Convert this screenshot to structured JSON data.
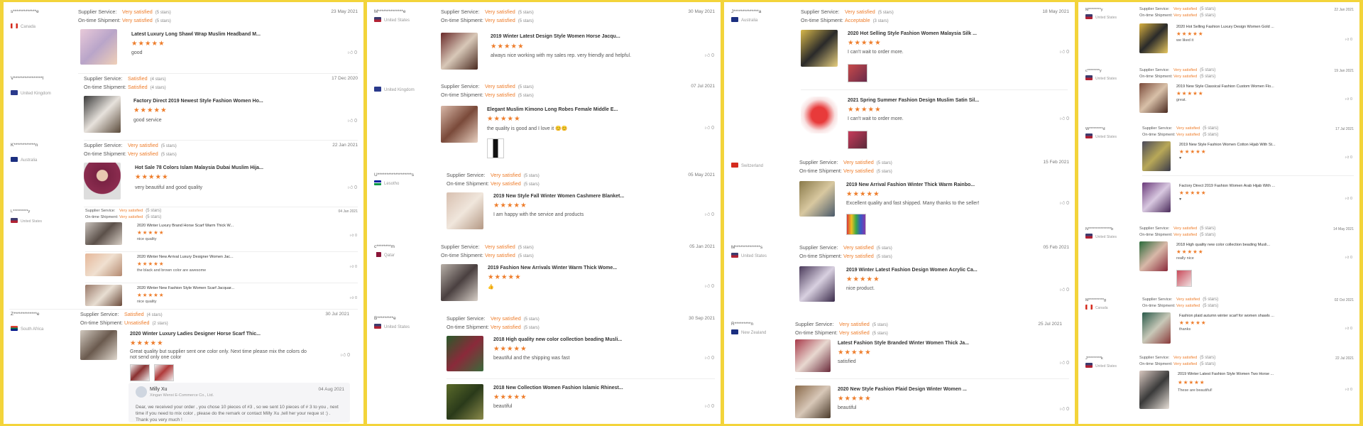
{
  "labels": {
    "supplier": "Supplier Service:",
    "shipment": "On-time Shipment:"
  },
  "colors": {
    "accent": "#ee7d2b",
    "frame": "#f3d43a"
  },
  "col1": [
    {
      "user": "s*************e",
      "country": "Canada",
      "flag": "ca",
      "svc": "Very satisfied",
      "svcStars": "(5 stars)",
      "ship": "Very satisfied",
      "shipStars": "(5 stars)",
      "date": "23 May 2021",
      "items": [
        {
          "title": "Latest Luxury Long Shawl Wrap Muslim Headband M...",
          "stars": "★★★★★",
          "comment": "good",
          "likes": "0"
        }
      ]
    },
    {
      "user": "V****************l",
      "country": "United Kingdom",
      "flag": "gb",
      "svc": "Satisfied",
      "svcStars": "(4 stars)",
      "ship": "Satisfied",
      "shipStars": "(4 stars)",
      "date": "17 Dec 2020",
      "items": [
        {
          "title": "Factory Direct 2019 Newest Style Fashion Women Ho...",
          "stars": "★★★★★",
          "comment": "good service",
          "likes": "0"
        }
      ]
    },
    {
      "user": "K************n",
      "country": "Australia",
      "flag": "au",
      "svc": "Very satisfied",
      "svcStars": "(5 stars)",
      "ship": "Very satisfied",
      "shipStars": "(5 stars)",
      "date": "22 Jan 2021",
      "items": [
        {
          "title": "Hot Sale 78 Colors Islam Malaysia Dubai Muslim Hija...",
          "stars": "★★★★★",
          "comment": "very beautiful and good quality",
          "likes": "0"
        }
      ]
    },
    {
      "user": "L**********y",
      "country": "United States",
      "flag": "us",
      "svc": "Very satisfied",
      "svcStars": "(5 stars)",
      "ship": "Very satisfied",
      "shipStars": "(5 stars)",
      "date": "04 Jan 2021",
      "items": [
        {
          "title": "2020 Winter Luxury Brand Horse Scarf Warm Thick W...",
          "stars": "★★★★★",
          "comment": "nice quality",
          "likes": "0"
        },
        {
          "title": "2020 Winter New Arrival Luxury Designer Women Jac...",
          "stars": "★★★★★",
          "comment": "the black and brown color are awesome",
          "likes": "0"
        },
        {
          "title": "2020 Winter New Fashion Style Women Scarf Jacquar...",
          "stars": "★★★★★",
          "comment": "nice quality",
          "likes": "0"
        }
      ]
    },
    {
      "user": "Z*************e",
      "country": "South Africa",
      "flag": "za",
      "svc": "Satisfied",
      "svcStars": "(4 stars)",
      "ship": "Unsatisfied",
      "shipStars": "(2 stars)",
      "date": "30 Jul 2021",
      "items": [
        {
          "title": "2020 Winter Luxury Ladies Designer Horse Scarf Thic...",
          "stars": "★★★★★",
          "comment": "Great quality but supplier sent one color only. Next time please mix the colors do",
          "comment2": "not send only one color",
          "likes": "0"
        }
      ],
      "reply": {
        "name": "Milly Xu",
        "company": "Xingan Wenxi E-Commerce Co., Ltd.",
        "date": "04 Aug 2021",
        "text": "Dear, we received your order , you chose 10 pieces of #3 , so we sent 10 pieces of # 3 to you , next time if you need to mix color , please do the remark or contact Milly Xu ,tell her your reque st :) . Thank you very much !"
      }
    }
  ],
  "col2": [
    {
      "user": "M**************e",
      "country": "United States",
      "flag": "us",
      "svc": "Very satisfied",
      "svcStars": "(5 stars)",
      "ship": "Very satisfied",
      "shipStars": "(5 stars)",
      "date": "30 May 2021",
      "items": [
        {
          "title": "2019 Winter Latest Design Style Women Horse Jacqu...",
          "stars": "★★★★★",
          "comment": "always nice working with my sales rep. very friendly and helpful.",
          "likes": "0"
        }
      ]
    },
    {
      "user": "",
      "country": "United Kingdom",
      "flag": "gb",
      "svc": "Very satisfied",
      "svcStars": "(5 stars)",
      "ship": "Very satisfied",
      "shipStars": "(5 stars)",
      "date": "07 Jul 2021",
      "items": [
        {
          "title": "Elegant Muslim Kimono Long Robes Female Middle E...",
          "stars": "★★★★★",
          "comment": "the quality is good and I love it 😊😊",
          "likes": "0"
        }
      ]
    },
    {
      "user": "U*******************s",
      "country": "Lesotho",
      "flag": "ls",
      "svc": "Very satisfied",
      "svcStars": "(5 stars)",
      "ship": "Very satisfied",
      "shipStars": "(5 stars)",
      "date": "05 May 2021",
      "items": [
        {
          "title": "2019 New Style Fall Winter Women Cashmere Blanket...",
          "stars": "★★★★★",
          "comment": "I am happy with the service and products",
          "likes": "0"
        }
      ]
    },
    {
      "user": "c********m",
      "country": "Qatar",
      "flag": "qa",
      "svc": "Very satisfied",
      "svcStars": "(5 stars)",
      "ship": "Very satisfied",
      "shipStars": "(5 stars)",
      "date": "05 Jan 2021",
      "items": [
        {
          "title": "2019 Fashion New Arrivals Winter Warm Thick Wome...",
          "stars": "★★★★★",
          "comment": "👍",
          "likes": "0"
        }
      ]
    },
    {
      "user": "B*********e",
      "country": "United States",
      "flag": "us",
      "svc": "Very satisfied",
      "svcStars": "(5 stars)",
      "ship": "Very satisfied",
      "shipStars": "(5 stars)",
      "date": "30 Sep 2021",
      "items": [
        {
          "title": "2018 High quality new color collection beading Musli...",
          "stars": "★★★★★",
          "comment": "beautiful and the shipping was fast",
          "likes": "0"
        },
        {
          "title": "2018 New Collection Women Fashion Islamic Rhinest...",
          "stars": "★★★★★",
          "comment": "beautiful",
          "likes": "0"
        }
      ]
    }
  ],
  "col3": [
    {
      "user": "J**************a",
      "country": "Australia",
      "flag": "au",
      "svc": "Very satisfied",
      "svcStars": "(5 stars)",
      "ship": "Acceptable",
      "shipStars": "(3 stars)",
      "date": "18 May 2021",
      "items": [
        {
          "title": "2020 Hot Selling Style Fashion Women Malaysia Silk ...",
          "stars": "★★★★★",
          "comment": "I can't wait to order more.",
          "likes": "0"
        },
        {
          "title": "2021 Spring Summer Fashion Design Muslim Satin Sil...",
          "stars": "★★★★★",
          "comment": "I can't wait to order more.",
          "likes": "0"
        }
      ]
    },
    {
      "user": "",
      "country": "Switzerland",
      "flag": "ch",
      "svc": "Very satisfied",
      "svcStars": "(5 stars)",
      "ship": "Very satisfied",
      "shipStars": "(5 stars)",
      "date": "15 Feb 2021",
      "items": [
        {
          "title": "2019 New Arrival Fashion Winter Thick Warm Rainbo...",
          "stars": "★★★★★",
          "comment": "Excellent quality and fast shipped. Many thanks to the seller!",
          "likes": "0"
        }
      ]
    },
    {
      "user": "M**************s",
      "country": "United States",
      "flag": "us",
      "svc": "Very satisfied",
      "svcStars": "(5 stars)",
      "ship": "Very satisfied",
      "shipStars": "(5 stars)",
      "date": "05 Feb 2021",
      "items": [
        {
          "title": "2019 Winter Latest Fashion Design Women Acrylic Ca...",
          "stars": "★★★★★",
          "comment": "nice product.",
          "likes": "0"
        }
      ]
    },
    {
      "user": "R*********n",
      "country": "New Zealand",
      "flag": "nz",
      "svc": "Very satisfied",
      "svcStars": "(5 stars)",
      "ship": "Very satisfied",
      "shipStars": "(5 stars)",
      "date": "25 Jul 2021",
      "items": [
        {
          "title": "Latest Fashion Style Branded Winter Women Thick Ja...",
          "stars": "★★★★★",
          "comment": "satisfied",
          "likes": "0"
        },
        {
          "title": "2020 New Style Fashion Plaid Design Winter Women ...",
          "stars": "★★★★★",
          "comment": "beautiful",
          "likes": "0"
        }
      ]
    }
  ],
  "col4": [
    {
      "user": "M********y",
      "country": "United States",
      "flag": "us",
      "svc": "Very satisfied",
      "svcStars": "(5 stars)",
      "ship": "Very satisfied",
      "shipStars": "(5 stars)",
      "date": "22 Jan 2021",
      "items": [
        {
          "title": "2020 Hot Selling Fashion Luxury Design Women Gold ...",
          "stars": "★★★★★",
          "comment": "we liked it",
          "likes": "0"
        }
      ]
    },
    {
      "user": "c********y",
      "country": "United States",
      "flag": "us",
      "svc": "Very satisfied",
      "svcStars": "(5 stars)",
      "ship": "Very satisfied",
      "shipStars": "(5 stars)",
      "date": "19 Jan 2021",
      "items": [
        {
          "title": "2019 New Style Classical Fashion Custom Women Flo...",
          "stars": "★★★★★",
          "comment": "great.",
          "likes": "0"
        }
      ]
    },
    {
      "user": "W*********d",
      "country": "United States",
      "flag": "us",
      "svc": "Very satisfied",
      "svcStars": "(5 stars)",
      "ship": "Very satisfied",
      "shipStars": "(5 stars)",
      "date": "17 Jul 2021",
      "items": [
        {
          "title": "2019 New Style Fashion Women Cotton Hijab With St...",
          "stars": "★★★★★",
          "comment": "♥",
          "likes": "0"
        },
        {
          "title": "Factory Direct 2019 Fashion Women Arab Hijab With ...",
          "stars": "★★★★★",
          "comment": "♥",
          "likes": "0"
        }
      ]
    },
    {
      "user": "N***************b",
      "country": "United States",
      "flag": "us",
      "svc": "Very satisfied",
      "svcStars": "(5 stars)",
      "ship": "Very satisfied",
      "shipStars": "(5 stars)",
      "date": "14 May 2021",
      "items": [
        {
          "title": "2018 High quality new color collection beading Musli...",
          "stars": "★★★★★",
          "comment": "really nice",
          "likes": "0"
        }
      ]
    },
    {
      "user": "M**********g",
      "country": "Canada",
      "flag": "ca",
      "svc": "Very satisfied",
      "svcStars": "(5 stars)",
      "ship": "Very satisfied",
      "shipStars": "(5 stars)",
      "date": "02 Oct 2021",
      "items": [
        {
          "title": "Fashion plaid autumn winter scarf for women shawls ...",
          "stars": "★★★★★",
          "comment": "thanks",
          "likes": "0"
        }
      ]
    },
    {
      "user": "J*********k",
      "country": "United States",
      "flag": "us",
      "svc": "Very satisfied",
      "svcStars": "(5 stars)",
      "ship": "Very satisfied",
      "shipStars": "(5 stars)",
      "date": "22 Jul 2021",
      "items": [
        {
          "title": "2019 Winter Latest Fashion Style Women Two Horse ...",
          "stars": "★★★★★",
          "comment": "These are beautiful!",
          "likes": "0"
        }
      ]
    }
  ]
}
